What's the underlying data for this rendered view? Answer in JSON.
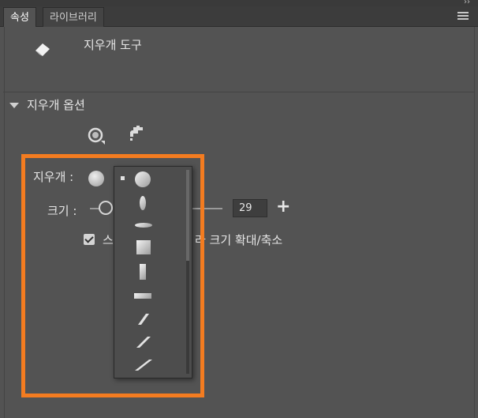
{
  "tabs": [
    {
      "label": "속성",
      "active": true
    },
    {
      "label": "라이브러리",
      "active": false
    }
  ],
  "tool": {
    "title": "지우개 도구",
    "icon": "eraser-icon"
  },
  "section": {
    "title": "지우개 옵션"
  },
  "mode_icons": [
    "eraser-mode-icon",
    "faucet-icon"
  ],
  "eraser": {
    "label": "지우개 :",
    "selected_shape": "circle-large"
  },
  "size": {
    "label": "크기 :",
    "value": "29",
    "plus_label": "+"
  },
  "checkbox": {
    "label_part1": "스",
    "label_part2": "라 크기 확대/축소",
    "checked": true
  },
  "shape_options": [
    "circle-large",
    "ellipse-vertical",
    "ellipse-horizontal",
    "square-large",
    "rect-vertical",
    "rect-horizontal",
    "slash-small",
    "slash-medium",
    "slash-large"
  ],
  "colors": {
    "highlight": "#f47c20",
    "panel": "#535353",
    "tabbar": "#3c3c3c"
  }
}
